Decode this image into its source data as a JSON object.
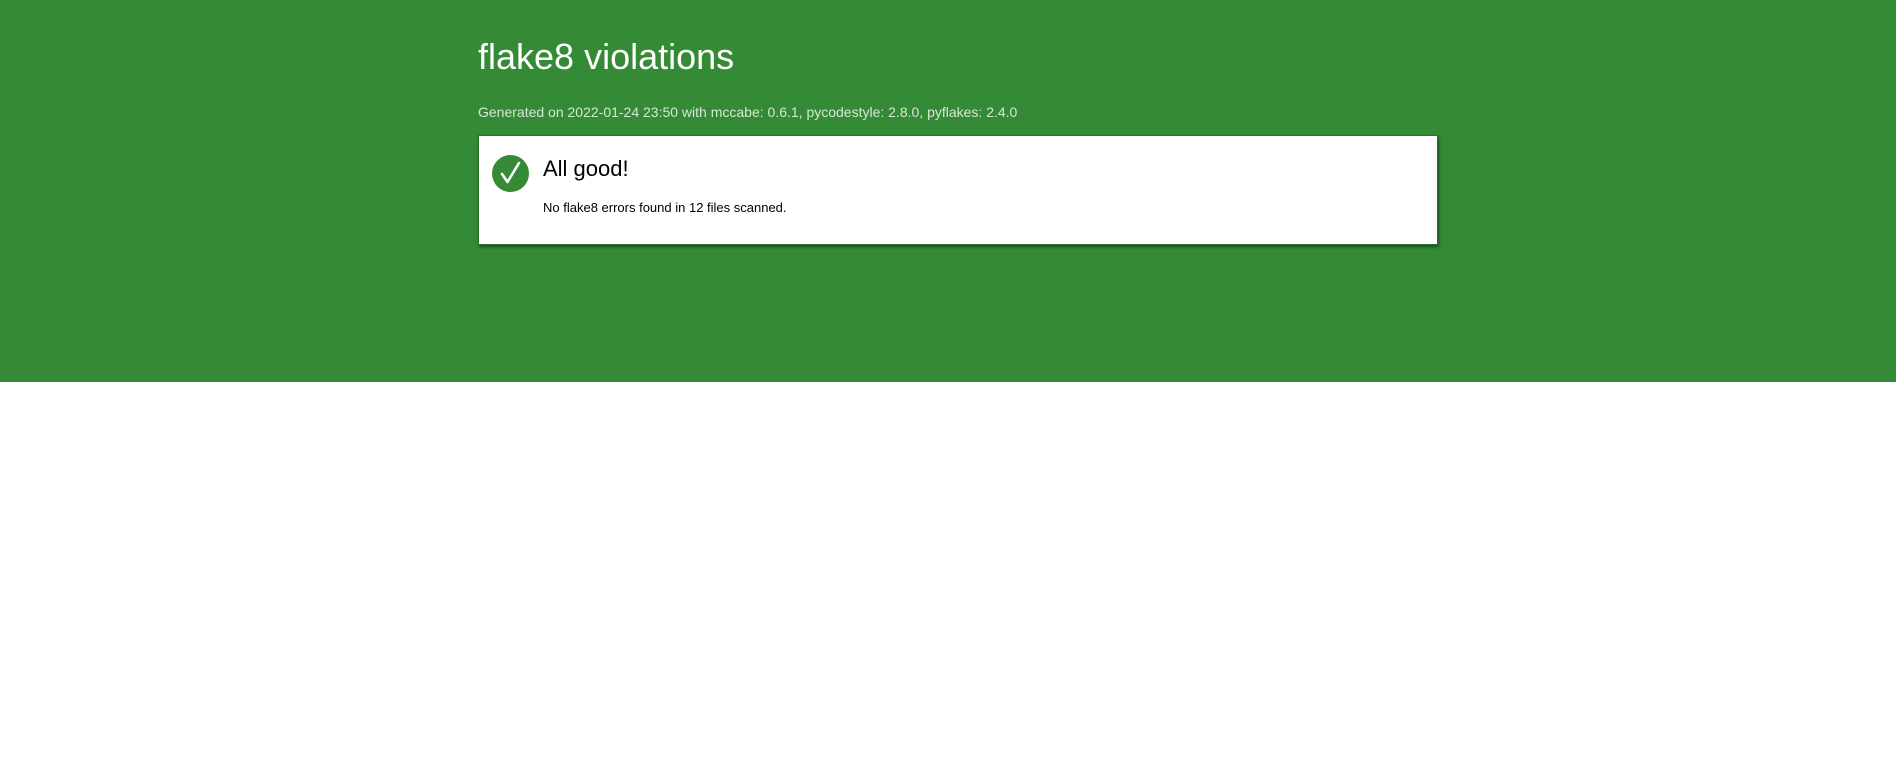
{
  "header": {
    "title": "flake8 violations",
    "generated": "Generated on 2022-01-24 23:50 with mccabe: 0.6.1, pycodestyle: 2.8.0, pyflakes: 2.4.0"
  },
  "result": {
    "icon": "check-circle-icon",
    "title": "All good!",
    "message": "No flake8 errors found in 12 files scanned."
  },
  "colors": {
    "banner": "#348a35",
    "card": "#ffffff",
    "generated_text": "#d6e8d6"
  }
}
